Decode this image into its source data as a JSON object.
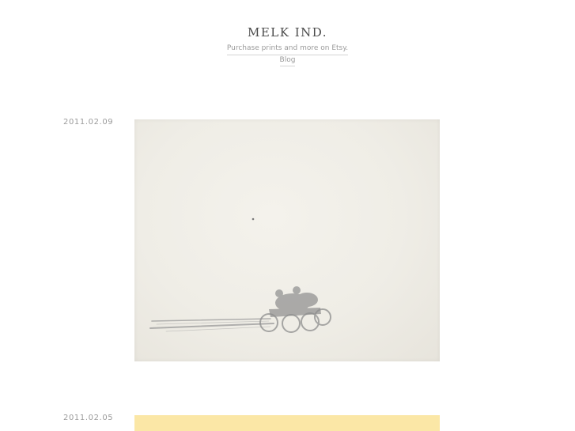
{
  "site": {
    "title": "MELK IND.",
    "links": [
      {
        "label": "Purchase prints and more on Etsy."
      },
      {
        "label": "Blog"
      }
    ]
  },
  "posts": [
    {
      "date": "2011.02.09",
      "image": "motorcycle-sketch-on-paper"
    },
    {
      "date": "2011.02.05",
      "image": "yellow-artwork",
      "color": "#fbe7a6"
    }
  ],
  "colors": {
    "paper": "#efede6",
    "yellow": "#fbe7a6",
    "text": "#8a8a8a"
  }
}
